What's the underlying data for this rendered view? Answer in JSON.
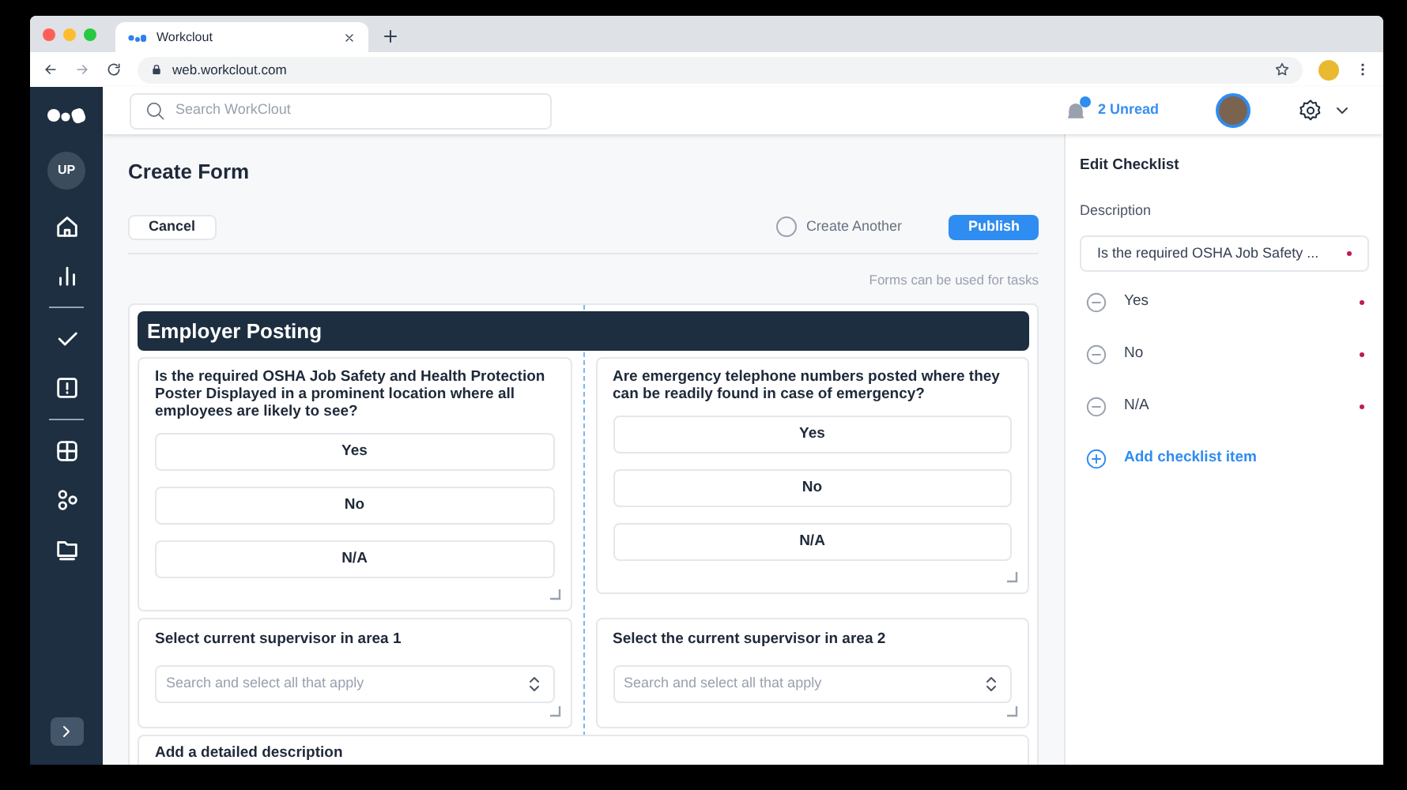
{
  "browser": {
    "tab_title": "Workclout",
    "url": "web.workclout.com"
  },
  "header": {
    "search_placeholder": "Search WorkClout",
    "notifications": "2 Unread"
  },
  "sidebar": {
    "avatar": "UP"
  },
  "page": {
    "title": "Create Form",
    "cancel": "Cancel",
    "create_another": {
      "label": "Create Another",
      "checked": false
    },
    "publish": "Publish",
    "hint": "Forms can be used for tasks"
  },
  "form": {
    "section_title": "Employer Posting",
    "rows": [
      [
        {
          "kind": "choice",
          "text": "Is the required OSHA Job Safety and Health Protection Poster Displayed in a prominent location where all employees are likely to see?",
          "options": [
            "Yes",
            "No",
            "N/A"
          ]
        },
        {
          "kind": "choice",
          "text": "Are emergency telephone numbers posted where they can be readily found in case of emergency?",
          "options": [
            "Yes",
            "No",
            "N/A"
          ]
        }
      ],
      [
        {
          "kind": "select",
          "text": "Select current supervisor in area 1",
          "placeholder": "Search and select all that apply"
        },
        {
          "kind": "select",
          "text": "Select the current supervisor in area 2",
          "placeholder": "Search and select all that apply"
        }
      ],
      [
        {
          "kind": "text",
          "text": "Add a detailed description"
        }
      ]
    ]
  },
  "panel": {
    "title": "Edit Checklist",
    "description_label": "Description",
    "description_value": "Is the required OSHA Job Safety ...",
    "description_required": true,
    "items": [
      {
        "label": "Yes",
        "required": true
      },
      {
        "label": "No",
        "required": true
      },
      {
        "label": "N/A",
        "required": true
      }
    ],
    "add_item": "Add checklist item"
  }
}
